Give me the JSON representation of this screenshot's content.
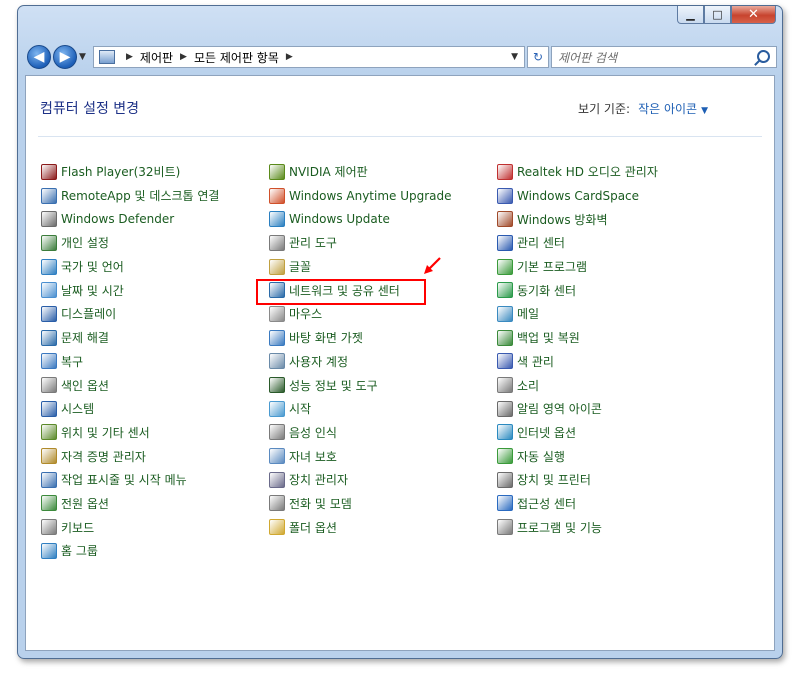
{
  "window": {
    "caption_buttons": [
      "minimize",
      "maximize",
      "close"
    ]
  },
  "nav": {
    "breadcrumb": [
      "제어판",
      "모든 제어판 항목"
    ],
    "search_placeholder": "제어판 검색"
  },
  "header": {
    "title": "컴퓨터 설정 변경",
    "view_by_label": "보기 기준:",
    "view_by_value": "작은 아이콘"
  },
  "columns": [
    [
      {
        "label": "Flash Player(32비트)",
        "icon": "flash-icon",
        "color": "#8b1a1a"
      },
      {
        "label": "RemoteApp 및 데스크톱 연결",
        "icon": "remote-desktop-icon",
        "color": "#3a6fb0"
      },
      {
        "label": "Windows Defender",
        "icon": "defender-icon",
        "color": "#6b6b6b"
      },
      {
        "label": "개인 설정",
        "icon": "personalization-icon",
        "color": "#3c7d3c"
      },
      {
        "label": "국가 및 언어",
        "icon": "globe-icon",
        "color": "#2f7fc1"
      },
      {
        "label": "날짜 및 시간",
        "icon": "clock-icon",
        "color": "#4a8fd0"
      },
      {
        "label": "디스플레이",
        "icon": "display-icon",
        "color": "#2a5ea8"
      },
      {
        "label": "문제 해결",
        "icon": "troubleshoot-icon",
        "color": "#2a6aa8"
      },
      {
        "label": "복구",
        "icon": "recovery-icon",
        "color": "#3a78c0"
      },
      {
        "label": "색인 옵션",
        "icon": "indexing-icon",
        "color": "#7a7a7a"
      },
      {
        "label": "시스템",
        "icon": "system-icon",
        "color": "#2a5ea8"
      },
      {
        "label": "위치 및 기타 센서",
        "icon": "sensor-icon",
        "color": "#5c8a2a"
      },
      {
        "label": "자격 증명 관리자",
        "icon": "credential-icon",
        "color": "#b08a2a"
      },
      {
        "label": "작업 표시줄 및 시작 메뉴",
        "icon": "taskbar-icon",
        "color": "#3a6fb0"
      },
      {
        "label": "전원 옵션",
        "icon": "power-icon",
        "color": "#3c8a3c"
      },
      {
        "label": "키보드",
        "icon": "keyboard-icon",
        "color": "#7a7a7a"
      },
      {
        "label": "홈 그룹",
        "icon": "homegroup-icon",
        "color": "#2f7fc1"
      }
    ],
    [
      {
        "label": "NVIDIA 제어판",
        "icon": "nvidia-icon",
        "color": "#5a8a1a"
      },
      {
        "label": "Windows Anytime Upgrade",
        "icon": "windows-flag-icon",
        "color": "#d0502a"
      },
      {
        "label": "Windows Update",
        "icon": "windows-update-icon",
        "color": "#2a7fc0"
      },
      {
        "label": "관리 도구",
        "icon": "admin-tools-icon",
        "color": "#7a7a7a"
      },
      {
        "label": "글꼴",
        "icon": "fonts-icon",
        "color": "#c0a040"
      },
      {
        "label": "네트워크 및 공유 센터",
        "icon": "network-icon",
        "color": "#2a6aa8"
      },
      {
        "label": "마우스",
        "icon": "mouse-icon",
        "color": "#8a8a8a"
      },
      {
        "label": "바탕 화면 가젯",
        "icon": "gadgets-icon",
        "color": "#3a7ac0"
      },
      {
        "label": "사용자 계정",
        "icon": "user-accounts-icon",
        "color": "#6a8aa8"
      },
      {
        "label": "성능 정보 및 도구",
        "icon": "performance-icon",
        "color": "#2a5a2a"
      },
      {
        "label": "시작",
        "icon": "getting-started-icon",
        "color": "#4a9ad0"
      },
      {
        "label": "음성 인식",
        "icon": "microphone-icon",
        "color": "#7a7a7a"
      },
      {
        "label": "자녀 보호",
        "icon": "parental-controls-icon",
        "color": "#5a8ac0"
      },
      {
        "label": "장치 관리자",
        "icon": "device-manager-icon",
        "color": "#6a6a8a"
      },
      {
        "label": "전화 및 모뎀",
        "icon": "phone-modem-icon",
        "color": "#7a7a7a"
      },
      {
        "label": "폴더 옵션",
        "icon": "folder-options-icon",
        "color": "#d0a830"
      }
    ],
    [
      {
        "label": "Realtek HD 오디오 관리자",
        "icon": "realtek-audio-icon",
        "color": "#c03030"
      },
      {
        "label": "Windows CardSpace",
        "icon": "cardspace-icon",
        "color": "#3a5ab0"
      },
      {
        "label": "Windows 방화벽",
        "icon": "firewall-icon",
        "color": "#a04a2a"
      },
      {
        "label": "관리 센터",
        "icon": "action-center-flag-icon",
        "color": "#2a5ab0"
      },
      {
        "label": "기본 프로그램",
        "icon": "default-programs-icon",
        "color": "#3a9a3a"
      },
      {
        "label": "동기화 센터",
        "icon": "sync-center-icon",
        "color": "#2a9a4a"
      },
      {
        "label": "메일",
        "icon": "mail-icon",
        "color": "#3a8ac0"
      },
      {
        "label": "백업 및 복원",
        "icon": "backup-icon",
        "color": "#3a8a3a"
      },
      {
        "label": "색 관리",
        "icon": "color-management-icon",
        "color": "#3a5ab0"
      },
      {
        "label": "소리",
        "icon": "sound-icon",
        "color": "#7a7a7a"
      },
      {
        "label": "알림 영역 아이콘",
        "icon": "notification-area-icon",
        "color": "#6a6a6a"
      },
      {
        "label": "인터넷 옵션",
        "icon": "internet-options-icon",
        "color": "#2a8ac0"
      },
      {
        "label": "자동 실행",
        "icon": "autoplay-icon",
        "color": "#3a9a3a"
      },
      {
        "label": "장치 및 프린터",
        "icon": "printer-icon",
        "color": "#6a6a6a"
      },
      {
        "label": "접근성 센터",
        "icon": "ease-of-access-icon",
        "color": "#2a6ac0"
      },
      {
        "label": "프로그램 및 기능",
        "icon": "programs-features-icon",
        "color": "#7a7a7a"
      }
    ]
  ],
  "annotation": {
    "highlight_color": "#ff0000"
  }
}
